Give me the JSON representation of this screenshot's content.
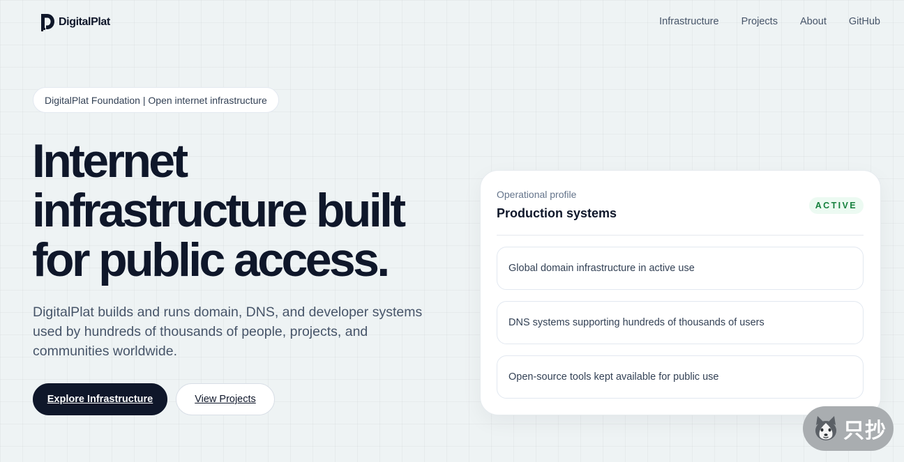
{
  "header": {
    "logo_text": "DigitalPlat",
    "nav": [
      {
        "label": "Infrastructure"
      },
      {
        "label": "Projects"
      },
      {
        "label": "About"
      },
      {
        "label": "GitHub"
      }
    ]
  },
  "hero": {
    "badge": "DigitalPlat Foundation | Open internet infrastructure",
    "title_lines": [
      "Internet",
      "infrastructure built",
      "for public access."
    ],
    "description": "DigitalPlat builds and runs domain, DNS, and developer systems used by hundreds of thousands of people, projects, and communities worldwide.",
    "primary_button": "Explore Infrastructure",
    "secondary_button": "View Projects"
  },
  "profile_card": {
    "eyebrow": "Operational profile",
    "title": "Production systems",
    "status": "ACTIVE",
    "items": [
      "Global domain infrastructure in active use",
      "DNS systems supporting hundreds of thousands of users",
      "Open-source tools kept available for public use"
    ]
  },
  "widget": {
    "label": "只抄",
    "icon": "husky-icon"
  },
  "colors": {
    "text_primary": "#0f172a",
    "text_secondary": "#475569",
    "status_green": "#15803d",
    "status_green_bg": "#ecfaf2",
    "background": "#eef3f4"
  }
}
